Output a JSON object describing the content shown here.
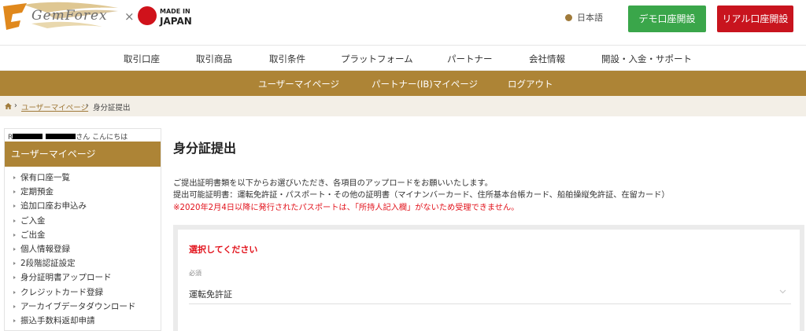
{
  "header": {
    "logo_text": "GemForex",
    "logo_x": "×",
    "made_in_line1": "MADE IN",
    "made_in_line2": "JAPAN",
    "language": "日本語",
    "demo_button": "デモ口座開設",
    "real_button": "リアル口座開設"
  },
  "main_nav": [
    "取引口座",
    "取引商品",
    "取引条件",
    "プラットフォーム",
    "パートナー",
    "会社情報",
    "開設・入金・サポート"
  ],
  "sub_nav": [
    "ユーザーマイページ",
    "パートナー(IB)マイページ",
    "ログアウト"
  ],
  "breadcrumb": {
    "sep1": "›",
    "link": "ユーザーマイページ",
    "sep2": "›",
    "current": "身分証提出"
  },
  "sidebar": {
    "greeting_prefix": "R",
    "greeting_suffix": "さん こんにちは",
    "title": "ユーザーマイページ",
    "items": [
      "保有口座一覧",
      "定期預金",
      "追加口座お申込み",
      "ご入金",
      "ご出金",
      "個人情報登録",
      "2段階認証設定",
      "身分証明書アップロード",
      "クレジットカード登録",
      "アーカイブデータダウンロード",
      "振込手数料返却申請"
    ]
  },
  "content": {
    "title": "身分証提出",
    "desc1": "ご提出証明書類を以下からお選びいただき、各項目のアップロードをお願いいたします。",
    "desc2": "提出可能証明書：運転免許証・パスポート・その他の証明書（マイナンバーカード、住所基本台帳カード、船舶操縦免許証、在留カード）",
    "desc3": "※2020年2月4日以降に発行されたパスポートは、「所持人記入欄」がないため受理できません。",
    "panel_heading": "選択してください",
    "required_label": "必須",
    "select_value": "運転免許証"
  },
  "colors": {
    "gold": "#ad8436",
    "demo_green": "#3aa64a",
    "real_red": "#c8141e",
    "warning_red": "#e2131c"
  }
}
